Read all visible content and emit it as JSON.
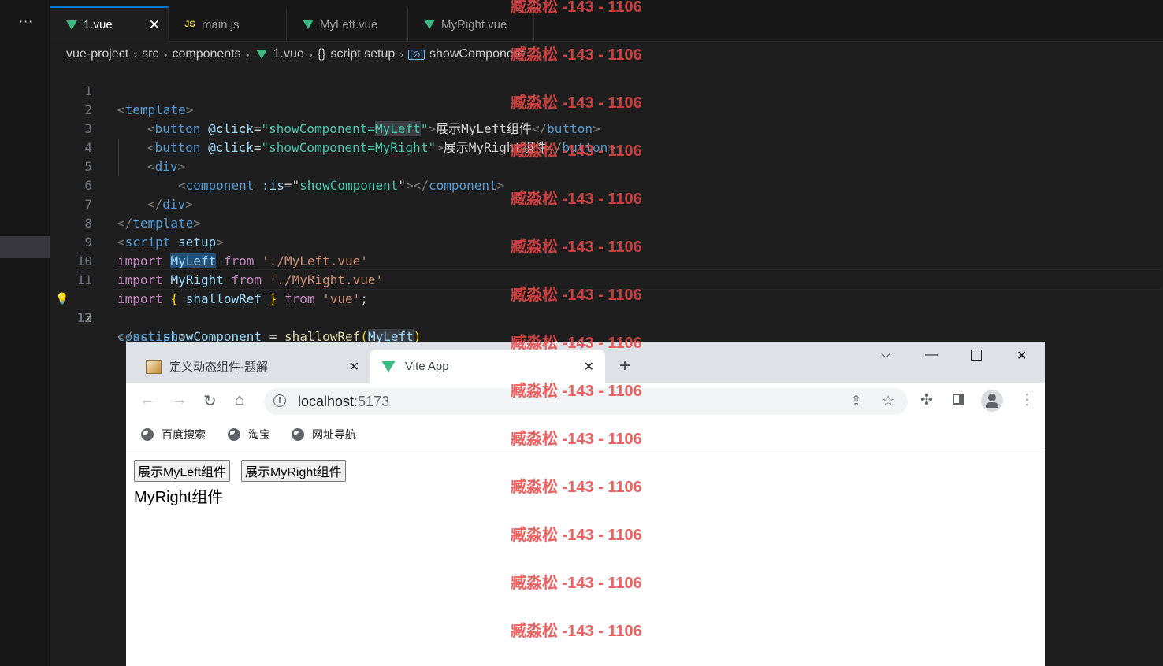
{
  "vscode": {
    "more_icon": "ellipsis-icon",
    "tabs": [
      {
        "label": "1.vue",
        "icon": "vue-icon",
        "active": true
      },
      {
        "label": "main.js",
        "icon": "js-icon"
      },
      {
        "label": "MyLeft.vue",
        "icon": "vue-icon"
      },
      {
        "label": "MyRight.vue",
        "icon": "vue-icon"
      }
    ],
    "breadcrumb": [
      "vue-project",
      "src",
      "components",
      "1.vue",
      "script setup",
      "showComponent"
    ],
    "line_numbers": [
      "1",
      "2",
      "3",
      "4",
      "5",
      "6",
      "7",
      "8",
      "9",
      "10",
      "11",
      "12",
      "13"
    ],
    "current_line": "12",
    "code": {
      "l1": [
        "<",
        "template",
        ">"
      ],
      "l2": [
        "<",
        "button",
        " ",
        "@click",
        "=",
        "\"",
        "showComponent=",
        "MyLeft",
        "\"",
        ">",
        "展示MyLeft组件",
        "</",
        "button",
        ">"
      ],
      "l3": [
        "<",
        "button",
        " ",
        "@click",
        "=",
        "\"",
        "showComponent=MyRight",
        "\"",
        ">",
        "展示MyRight组件",
        "</",
        "button",
        ">"
      ],
      "l4": [
        "<",
        "div",
        ">"
      ],
      "l5": [
        "<",
        "component",
        " ",
        ":is",
        "=",
        "\"",
        "showComponent",
        "\"",
        "></",
        "component",
        ">"
      ],
      "l6": [
        "</",
        "div",
        ">"
      ],
      "l7": [
        "</",
        "template",
        ">"
      ],
      "l8": [
        "<",
        "script",
        " ",
        "setup",
        ">"
      ],
      "l9": [
        "import",
        " ",
        "MyLeft",
        " ",
        "from",
        " ",
        "'./MyLeft.vue'"
      ],
      "l10": [
        "import",
        " ",
        "MyRight",
        " ",
        "from",
        " ",
        "'./MyRight.vue'"
      ],
      "l11": [
        "import",
        " ",
        "{",
        " ",
        "shallowRef",
        " ",
        "}",
        " ",
        "from",
        " ",
        "'vue'",
        ";"
      ],
      "l12": [
        "const",
        " ",
        "showComponent",
        " ",
        "=",
        " ",
        "shallowRef",
        "(",
        "MyLeft",
        ")"
      ],
      "l13": [
        "</",
        "script",
        ">"
      ]
    }
  },
  "browser": {
    "tabs": [
      {
        "label": "定义动态组件-题解",
        "close": "✕"
      },
      {
        "label": "Vite App",
        "close": "✕"
      }
    ],
    "new_tab": "+",
    "address_host": "localhost",
    "address_port": ":5173",
    "bookmarks": [
      "百度搜索",
      "淘宝",
      "网址导航"
    ],
    "page": {
      "buttons": [
        "展示MyLeft组件",
        "展示MyRight组件"
      ],
      "output": "MyRight组件"
    }
  },
  "watermark": {
    "text": "臧淼松 -143 - 1106",
    "color": "#e64646"
  }
}
